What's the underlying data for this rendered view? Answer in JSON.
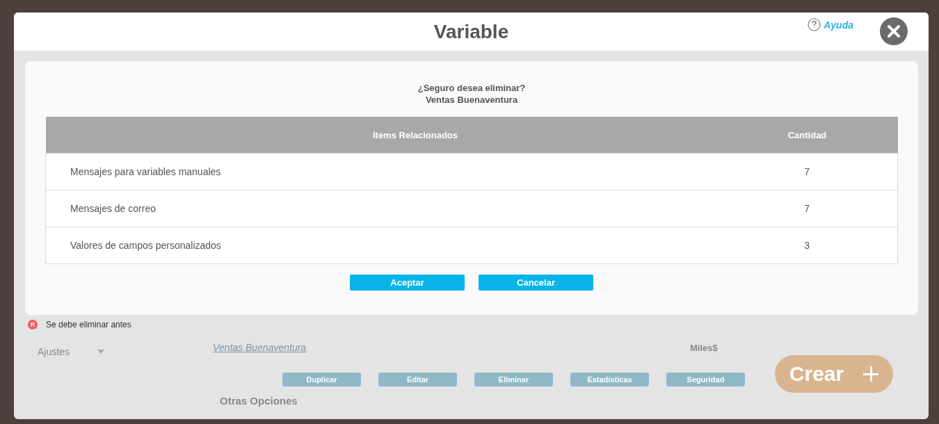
{
  "window": {
    "title": "Variable",
    "help_label": "Ayuda"
  },
  "confirm": {
    "question": "¿Seguro desea eliminar?",
    "item_name": "Ventas Buenaventura",
    "table": {
      "columns": [
        "Items Relacionados",
        "Cantidad"
      ],
      "rows": [
        {
          "item": "Mensajes para variables manuales",
          "count": "7"
        },
        {
          "item": "Mensajes de correo",
          "count": "7"
        },
        {
          "item": "Valores de campos personalizados",
          "count": "3"
        }
      ]
    },
    "buttons": [
      "Aceptar",
      "Cancelar"
    ]
  },
  "legend": {
    "badge": "R",
    "text": "Se debe eliminar antes"
  },
  "background": {
    "dropdown": "Ajustes",
    "variable_link": "Ventas Buenaventura",
    "unit": "Miles$",
    "actions": [
      "Duplicar",
      "Editar",
      "Eliminar",
      "Estadísticas",
      "Seguridad"
    ],
    "section_title": "Otras Opciones",
    "create_button": "Crear"
  }
}
